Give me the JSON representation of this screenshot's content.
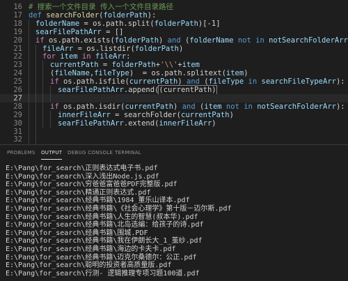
{
  "editor": {
    "lines": [
      {
        "n": "16",
        "segs": [
          [
            "cm",
            "# 搜索一个文件目录 传入一个文件目录路径"
          ]
        ]
      },
      {
        "n": "17",
        "segs": [
          [
            "kw",
            "def "
          ],
          [
            "fn",
            "searchFolder"
          ],
          [
            "p",
            "("
          ],
          [
            "var",
            "folderPath"
          ],
          [
            "p",
            "):"
          ]
        ]
      },
      {
        "n": "18",
        "segs": [
          [
            "var",
            "folderName"
          ],
          [
            "p",
            " = os.path.split("
          ],
          [
            "var",
            "folderPath"
          ],
          [
            "p",
            ")[-1]"
          ]
        ]
      },
      {
        "n": "19",
        "segs": [
          [
            "var",
            "searFilePathArr"
          ],
          [
            "p",
            " = []"
          ]
        ]
      },
      {
        "n": "20",
        "segs": [
          [
            "ctl",
            "if "
          ],
          [
            "p",
            "os.path.exists("
          ],
          [
            "var",
            "folderPath"
          ],
          [
            "p",
            ") "
          ],
          [
            "kw",
            "and"
          ],
          [
            "p",
            " ("
          ],
          [
            "var",
            "folderName"
          ],
          [
            "kw",
            " not in "
          ],
          [
            "var",
            "notSearchFolderArr"
          ],
          [
            "p",
            "):"
          ]
        ]
      },
      {
        "n": "21",
        "segs": [
          [
            "var",
            "fileArr"
          ],
          [
            "p",
            " = os.listdir("
          ],
          [
            "var",
            "folderPath"
          ],
          [
            "p",
            ")"
          ]
        ]
      },
      {
        "n": "22",
        "segs": [
          [
            "ctl",
            "for "
          ],
          [
            "var",
            "item"
          ],
          [
            "ctl",
            " in "
          ],
          [
            "var",
            "fileArr"
          ],
          [
            "p",
            ":"
          ]
        ]
      },
      {
        "n": "23",
        "segs": [
          [
            "var",
            "currentPath"
          ],
          [
            "p",
            " = "
          ],
          [
            "var",
            "folderPath"
          ],
          [
            "p",
            "+"
          ],
          [
            "str",
            "'\\\\'"
          ],
          [
            "p",
            "+"
          ],
          [
            "var",
            "item"
          ]
        ]
      },
      {
        "n": "24",
        "segs": [
          [
            "p",
            "("
          ],
          [
            "var",
            "fileName"
          ],
          [
            "p",
            ","
          ],
          [
            "var",
            "fileType"
          ],
          [
            "p",
            ")  = os.path.splitext("
          ],
          [
            "var",
            "item"
          ],
          [
            "p",
            ")"
          ]
        ]
      },
      {
        "n": "25",
        "segs": [
          [
            "ctl",
            "if "
          ],
          [
            "p",
            "os.path.isfile("
          ],
          [
            "var",
            "currentPath"
          ],
          [
            "p",
            ") "
          ],
          [
            "kw",
            "and"
          ],
          [
            "p",
            " ("
          ],
          [
            "var",
            "fileType"
          ],
          [
            "kw",
            " in "
          ],
          [
            "var",
            "searchFileTypeArr"
          ],
          [
            "p",
            "):"
          ]
        ]
      },
      {
        "n": "26",
        "segs": [
          [
            "var",
            "searFilePathArr"
          ],
          [
            "p",
            ".append("
          ],
          [
            "box",
            "(currentPath)"
          ]
        ]
      },
      {
        "n": "27",
        "segs": []
      },
      {
        "n": "28",
        "segs": [
          [
            "ctl",
            "if "
          ],
          [
            "p",
            "os.path.isdir("
          ],
          [
            "var",
            "currentPath"
          ],
          [
            "p",
            ") "
          ],
          [
            "kw",
            "and"
          ],
          [
            "p",
            " ("
          ],
          [
            "var",
            "item"
          ],
          [
            "kw",
            " not in "
          ],
          [
            "var",
            "notSearchFolderArr"
          ],
          [
            "p",
            "):"
          ]
        ]
      },
      {
        "n": "29",
        "segs": [
          [
            "var",
            "innerFileArr"
          ],
          [
            "p",
            " = searchFolder("
          ],
          [
            "var",
            "currentPath"
          ],
          [
            "p",
            ")"
          ]
        ]
      },
      {
        "n": "30",
        "segs": [
          [
            "var",
            "searFilePathArr"
          ],
          [
            "p",
            ".extend("
          ],
          [
            "var",
            "innerFileArr"
          ],
          [
            "p",
            ")"
          ]
        ]
      },
      {
        "n": "31",
        "segs": []
      },
      {
        "n": "32",
        "segs": []
      }
    ]
  },
  "panel": {
    "tabs": [
      "PROBLEMS",
      "OUTPUT",
      "DEBUG CONSOLE",
      "TERMINAL"
    ],
    "active_tab": "OUTPUT"
  },
  "output": {
    "lines": [
      "E:\\Pang\\for_search\\正则表达式电子书.pdf",
      "E:\\Pang\\for_search\\深入浅出Node.js.pdf",
      "E:\\Pang\\for_search\\穷爸爸富爸爸PDF完整版.pdf",
      "E:\\Pang\\for_search\\精通正则表达式.pdf",
      "E:\\Pang\\for_search\\经典书籍\\1984_董乐山译本.pdf",
      "E:\\Pang\\for_search\\经典书籍\\《社会心理学》第十版－迈尔斯.pdf",
      "E:\\Pang\\for_search\\经典书籍\\人生的智慧(叔本华).pdf",
      "E:\\Pang\\for_search\\经典书籍\\北岛选编：给孩子的诗.pdf",
      "E:\\Pang\\for_search\\经典书籍\\围城.PDF",
      "E:\\Pang\\for_search\\经典书籍\\我在伊朗长大_1_茧纱.pdf",
      "E:\\Pang\\for_search\\经典书籍\\海边的卡夫卡.pdf",
      "E:\\Pang\\for_search\\经典书籍\\迈克尔桑德尔：公正.pdf",
      "E:\\Pang\\for_search\\聪明的投资者高质量版.pdf",
      "E:\\Pang\\for_search\\行测- 逻辑推理专项习题100道.pdf"
    ]
  }
}
